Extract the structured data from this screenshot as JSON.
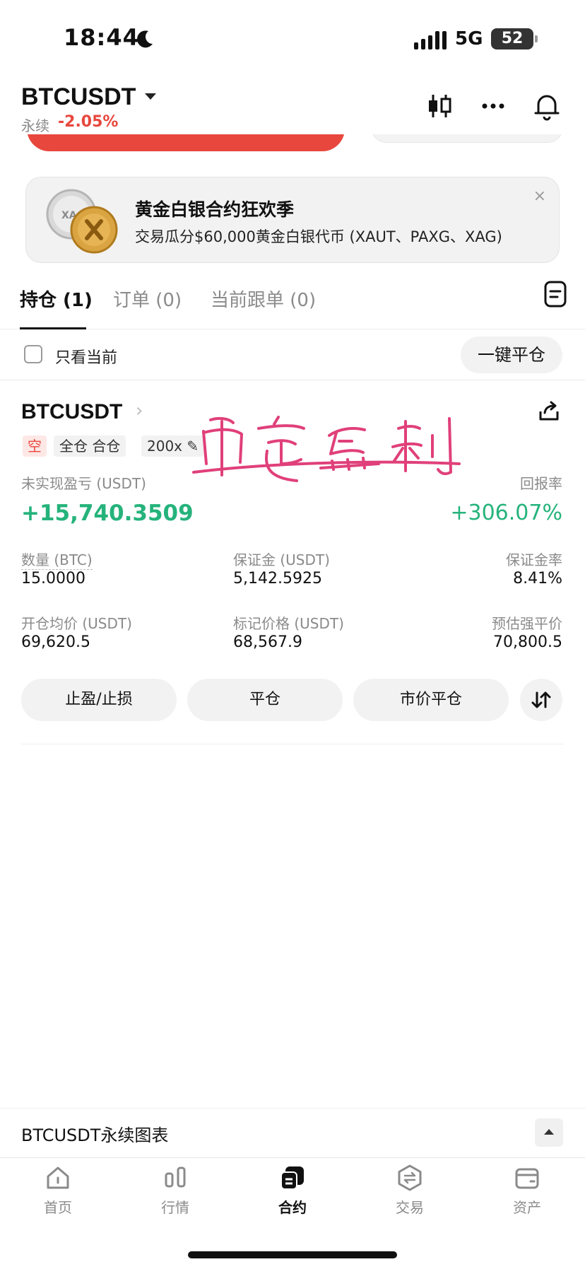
{
  "status_bar": {
    "time": "18:44",
    "network": "5G",
    "battery": "52"
  },
  "header": {
    "pair": "BTCUSDT",
    "contract_type": "永续",
    "change": "-2.05%"
  },
  "banner": {
    "title": "黄金白银合约狂欢季",
    "text": "交易瓜分$60,000黄金白银代币 (XAUT、PAXG、XAG)",
    "coin_label": "XAG",
    "close": "×"
  },
  "tabs": [
    {
      "label": "持仓 (1)"
    },
    {
      "label": "订单 (0)"
    },
    {
      "label": "当前跟单 (0)"
    }
  ],
  "filter": {
    "checkbox_label": "只看当前",
    "close_all": "一键平仓"
  },
  "position": {
    "symbol": "BTCUSDT",
    "side": "空",
    "margin_mode": "全仓 合仓",
    "leverage": "200x",
    "pnl_label": "未实现盈亏 (USDT)",
    "pnl_value": "+15,740.3509",
    "roe_label": "回报率",
    "roe_value": "+306.07%",
    "qty_label": "数量 (BTC)",
    "qty_value": "15.0000",
    "margin_label": "保证金 (USDT)",
    "margin_value": "5,142.5925",
    "margin_ratio_label": "保证金率",
    "margin_ratio_value": "8.41%",
    "entry_label": "开仓均价 (USDT)",
    "entry_value": "69,620.5",
    "mark_label": "标记价格 (USDT)",
    "mark_value": "68,567.9",
    "liq_label": "预估强平价",
    "liq_value": "70,800.5",
    "buttons": {
      "tpsl": "止盈/止损",
      "close": "平仓",
      "market_close": "市价平仓"
    }
  },
  "chart_bar": {
    "label": "BTCUSDT永续图表"
  },
  "nav": [
    {
      "label": "首页",
      "icon": "home-icon"
    },
    {
      "label": "行情",
      "icon": "market-icon"
    },
    {
      "label": "合约",
      "icon": "futures-icon"
    },
    {
      "label": "交易",
      "icon": "trade-icon"
    },
    {
      "label": "资产",
      "icon": "wallet-icon"
    }
  ],
  "colors": {
    "red": "#e8473d",
    "green": "#25b37b",
    "watermark": "#e0407a"
  }
}
